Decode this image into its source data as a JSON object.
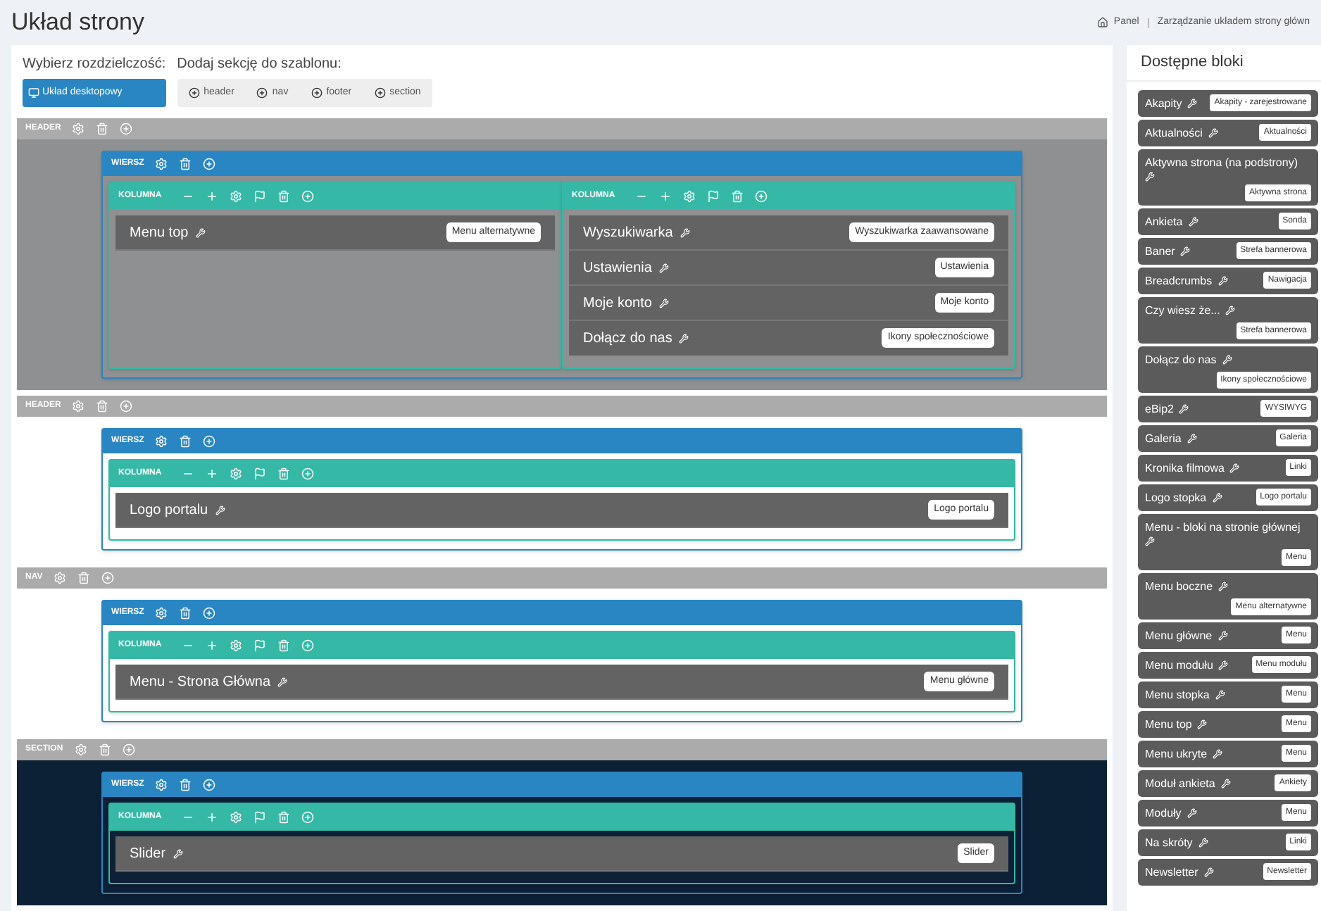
{
  "page_title": "Układ strony",
  "breadcrumb": [
    {
      "label": "Panel"
    },
    {
      "label": "Zarządzanie układem strony główn"
    }
  ],
  "toolbar": {
    "resolution_label": "Wybierz rozdzielczość:",
    "resolution_button": "Układ desktopowy",
    "add_section_label": "Dodaj sekcję do szablonu:",
    "add_buttons": [
      "header",
      "nav",
      "footer",
      "section"
    ]
  },
  "sections": [
    {
      "label": "HEADER",
      "color": "#8f9091",
      "rows": [
        {
          "label": "WIERSZ",
          "columns": [
            {
              "label": "KOLUMNA",
              "blocks": [
                {
                  "name": "Menu top",
                  "badge": "Menu alternatywne"
                }
              ]
            },
            {
              "label": "KOLUMNA",
              "blocks": [
                {
                  "name": "Wyszukiwarka",
                  "badge": "Wyszukiwarka zaawansowane"
                },
                {
                  "name": "Ustawienia",
                  "badge": "Ustawienia"
                },
                {
                  "name": "Moje konto",
                  "badge": "Moje konto"
                },
                {
                  "name": "Dołącz do nas",
                  "badge": "Ikony społecznościowe"
                }
              ]
            }
          ]
        }
      ]
    },
    {
      "label": "HEADER",
      "color": "#ffffff",
      "rows": [
        {
          "label": "WIERSZ",
          "columns": [
            {
              "label": "KOLUMNA",
              "blocks": [
                {
                  "name": "Logo portalu",
                  "badge": "Logo portalu"
                }
              ]
            }
          ]
        }
      ]
    },
    {
      "label": "NAV",
      "color": "#ffffff",
      "rows": [
        {
          "label": "WIERSZ",
          "columns": [
            {
              "label": "KOLUMNA",
              "blocks": [
                {
                  "name": "Menu - Strona Główna",
                  "badge": "Menu główne"
                }
              ]
            }
          ]
        }
      ]
    },
    {
      "label": "SECTION",
      "color": "#0c2136",
      "rows": [
        {
          "label": "WIERSZ",
          "columns": [
            {
              "label": "KOLUMNA",
              "blocks": [
                {
                  "name": "Slider",
                  "badge": "Slider"
                }
              ]
            }
          ]
        }
      ]
    }
  ],
  "sidebar": {
    "title": "Dostępne bloki",
    "blocks": [
      {
        "name": "Akapity",
        "badge": "Akapity - zarejestrowane"
      },
      {
        "name": "Aktualności",
        "badge": "Aktualności"
      },
      {
        "name": "Aktywna strona (na podstrony)",
        "badge": "Aktywna strona"
      },
      {
        "name": "Ankieta",
        "badge": "Sonda"
      },
      {
        "name": "Baner",
        "badge": "Strefa bannerowa"
      },
      {
        "name": "Breadcrumbs",
        "badge": "Nawigacja"
      },
      {
        "name": "Czy wiesz że...",
        "badge": "Strefa bannerowa"
      },
      {
        "name": "Dołącz do nas",
        "badge": "Ikony społecznościowe"
      },
      {
        "name": "eBip2",
        "badge": "WYSIWYG"
      },
      {
        "name": "Galeria",
        "badge": "Galeria"
      },
      {
        "name": "Kronika filmowa",
        "badge": "Linki"
      },
      {
        "name": "Logo stopka",
        "badge": "Logo portalu"
      },
      {
        "name": "Menu - bloki na stronie głównej",
        "badge": "Menu"
      },
      {
        "name": "Menu boczne",
        "badge": "Menu alternatywne"
      },
      {
        "name": "Menu główne",
        "badge": "Menu"
      },
      {
        "name": "Menu modułu",
        "badge": "Menu modułu"
      },
      {
        "name": "Menu stopka",
        "badge": "Menu"
      },
      {
        "name": "Menu top",
        "badge": "Menu"
      },
      {
        "name": "Menu ukryte",
        "badge": "Menu"
      },
      {
        "name": "Moduł ankieta",
        "badge": "Ankiety"
      },
      {
        "name": "Moduły",
        "badge": "Menu"
      },
      {
        "name": "Na skróty",
        "badge": "Linki"
      },
      {
        "name": "Newsletter",
        "badge": "Newsletter"
      }
    ]
  }
}
